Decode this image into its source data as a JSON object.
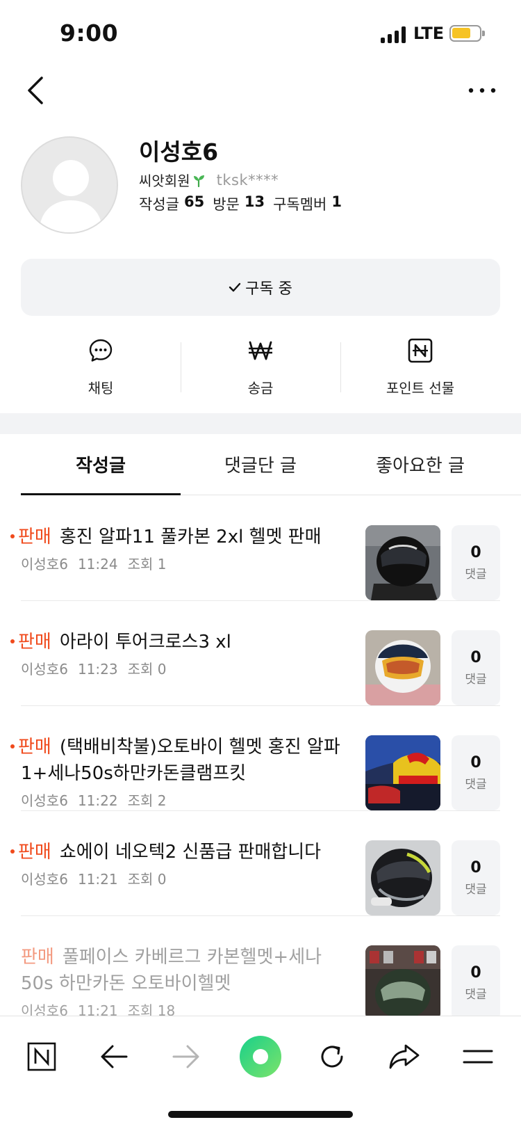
{
  "status_bar": {
    "time": "9:00",
    "network": "LTE"
  },
  "profile": {
    "name": "이성호6",
    "grade": "씨앗회원",
    "user_id": "tksk****",
    "stats": [
      {
        "label": "작성글",
        "value": "65"
      },
      {
        "label": "방문",
        "value": "13"
      },
      {
        "label": "구독멤버",
        "value": "1"
      }
    ]
  },
  "subscribe": {
    "label": "구독 중"
  },
  "actions": [
    {
      "label": "채팅",
      "icon": "chat-bubble-icon"
    },
    {
      "label": "송금",
      "icon": "won-icon"
    },
    {
      "label": "포인트 선물",
      "icon": "naver-point-icon"
    }
  ],
  "tabs": [
    {
      "label": "작성글",
      "active": true
    },
    {
      "label": "댓글단 글",
      "active": false
    },
    {
      "label": "좋아요한 글",
      "active": false
    }
  ],
  "posts": [
    {
      "tag": "판매",
      "title": "홍진 알파11 풀카본 2xl 헬멧 판매",
      "author": "이성호6",
      "time": "11:24",
      "views": "조회 1",
      "comments": "0",
      "comment_label": "댓글"
    },
    {
      "tag": "판매",
      "title": "아라이 투어크로스3 xl",
      "author": "이성호6",
      "time": "11:23",
      "views": "조회 0",
      "comments": "0",
      "comment_label": "댓글"
    },
    {
      "tag": "판매",
      "title": "(택배비착불)오토바이 헬멧 홍진 알파1+세나50s하만카돈클램프킷",
      "author": "이성호6",
      "time": "11:22",
      "views": "조회 2",
      "comments": "0",
      "comment_label": "댓글"
    },
    {
      "tag": "판매",
      "title": "쇼에이 네오텍2 신품급 판매합니다",
      "author": "이성호6",
      "time": "11:21",
      "views": "조회 0",
      "comments": "0",
      "comment_label": "댓글"
    },
    {
      "tag": "판매",
      "title": "풀페이스 카베르그 카본헬멧+세나50s 하만카돈 오토바이헬멧",
      "author": "이성호6",
      "time": "11:21",
      "views": "조회 18",
      "comments": "0",
      "comment_label": "댓글"
    }
  ],
  "colors": {
    "accent_red": "#f04a1c",
    "green": "#3fd07a",
    "battery": "#f6c324"
  }
}
